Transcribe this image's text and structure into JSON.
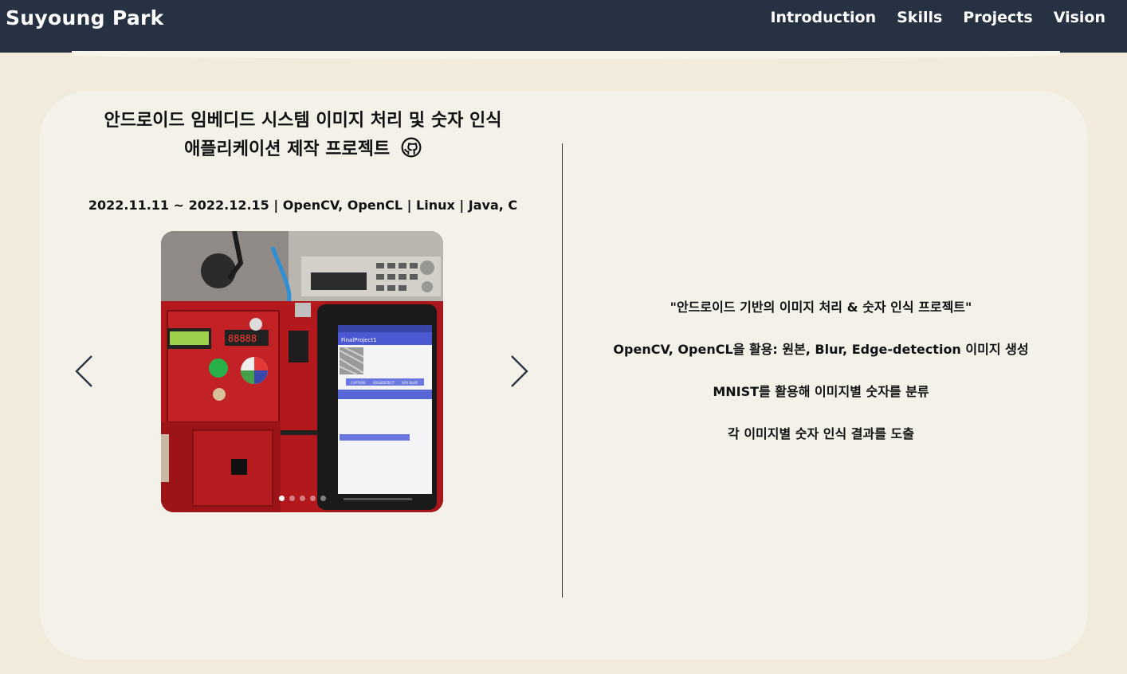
{
  "header": {
    "brand": "Suyoung Park",
    "nav": [
      "Introduction",
      "Skills",
      "Projects",
      "Vision"
    ]
  },
  "project": {
    "title_line1": "안드로이드 임베디드 시스템 이미지 처리 및 숫자 인식",
    "title_line2": "애플리케이션 제작 프로젝트",
    "github_icon": "github-icon",
    "meta": "2022.11.11 ~ 2022.12.15 | OpenCV, OpenCL | Linux | Java, C",
    "photo_screen_title": "FinalProject1",
    "photo_buttons": [
      "CAPTURE",
      "EDGEDETECT",
      "GPU BLUR"
    ],
    "description": [
      "\"안드로이드 기반의 이미지 처리 & 숫자 인식 프로젝트\"",
      "OpenCV, OpenCL을 활용: 원본, Blur, Edge-detection 이미지 생성",
      "MNIST를 활용해 이미지별 숫자를 분류",
      "각 이미지별 숫자 인식 결과를 도출"
    ],
    "carousel": {
      "current": 1,
      "total": 5,
      "prev_icon": "chevron-left-icon",
      "next_icon": "chevron-right-icon"
    }
  },
  "colors": {
    "header_bg": "#263242",
    "page_bg": "#f2ebdb",
    "card_bg": "#f3f1e8",
    "board_red": "#b3191c"
  }
}
